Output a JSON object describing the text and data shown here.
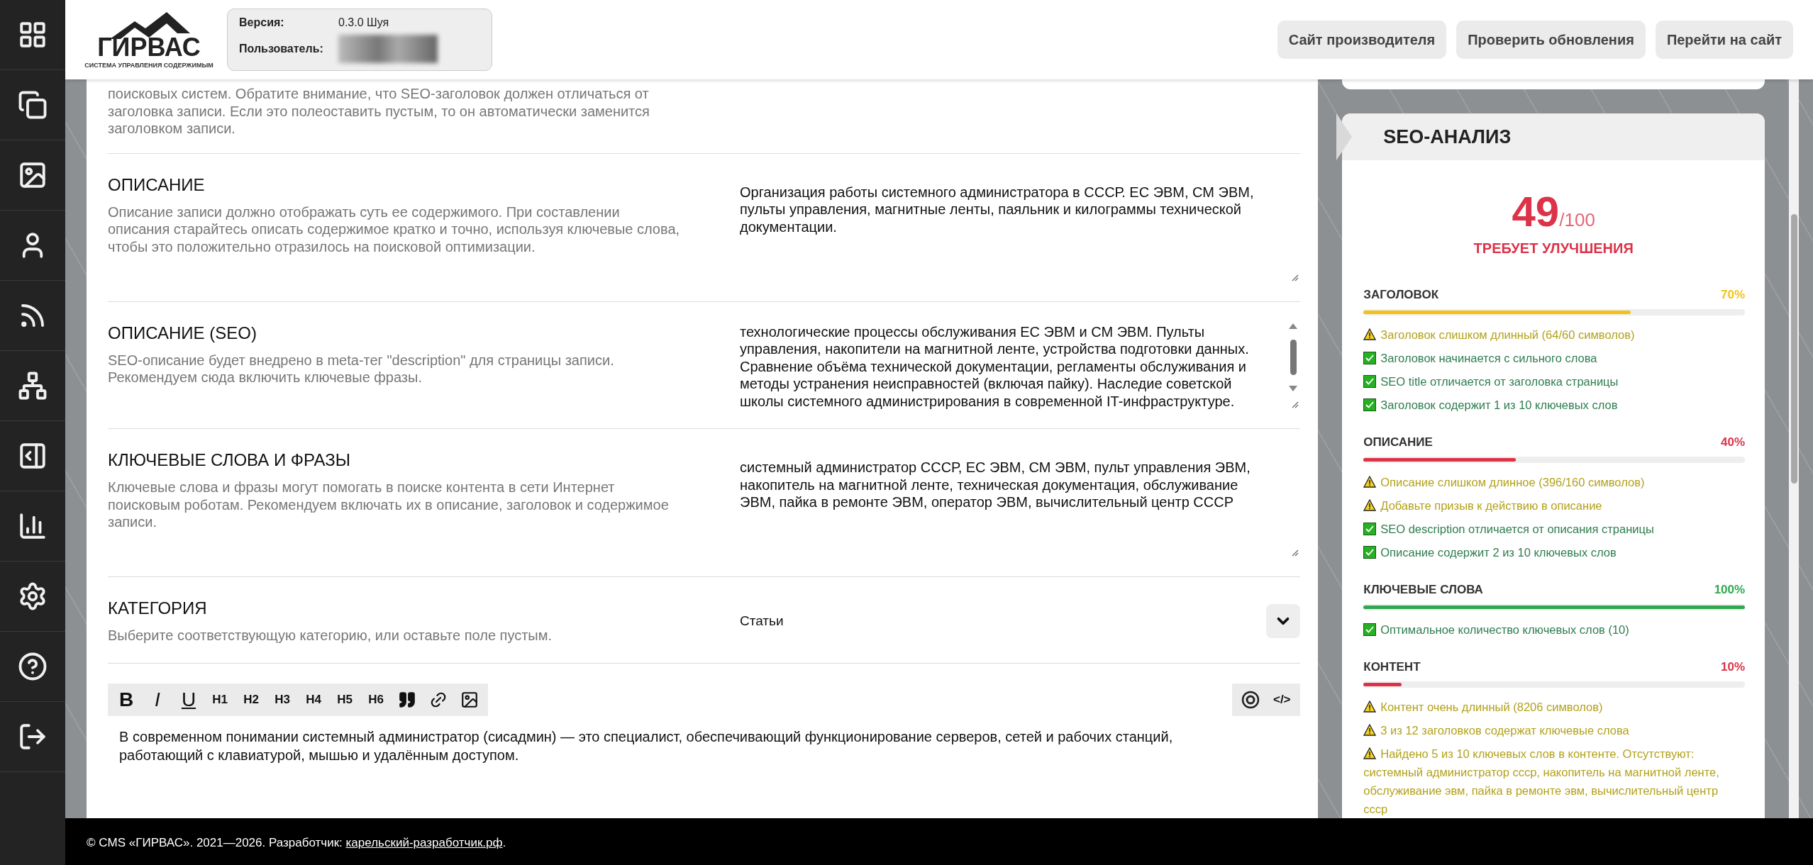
{
  "header": {
    "logo": {
      "name": "ГИРВАС",
      "tagline": "СИСТЕМА УПРАВЛЕНИЯ СОДЕРЖИМЫМ"
    },
    "info": [
      {
        "label": "Версия:",
        "kind": "text",
        "value": "0.3.0 Шуя"
      },
      {
        "label": "Пользователь:",
        "kind": "blurred"
      }
    ],
    "buttons": [
      "Сайт производителя",
      "Проверить обновления",
      "Перейти на сайт"
    ]
  },
  "form": {
    "sections": [
      {
        "kind": "note",
        "description": "поисковых систем. Обратите внимание, что SEO-заголовок должен отличаться от заголовка записи. Если это полеоставить пустым, то он автоматически заменится заголовком записи."
      },
      {
        "kind": "textarea",
        "title": "ОПИСАНИЕ",
        "description": "Описание записи должно отображать суть ее содержимого. При составлении описания старайтесь описать содержимое кратко и точно, используя ключевые слова, чтобы это положительно отразилось на поисковой оптимизации.",
        "value": "Организация работы системного администратора в СССР. ЕС ЭВМ, СМ ЭВМ, пульты управления, магнитные ленты, паяльник и килограммы технической документации."
      },
      {
        "kind": "scroll_textarea",
        "title": "ОПИСАНИЕ (SEO)",
        "description": "SEO-описание будет внедрено в meta-тег \"description\" для страницы записи. Рекомендуем сюда включить ключевые фразы.",
        "value": "технологические процессы обслуживания ЕС ЭВМ и СМ ЭВМ. Пульты управления, накопители на магнитной ленте, устройства подготовки данных. Сравнение объёма технической документации, регламенты обслуживания и методы устранения неисправностей (включая пайку). Наследие советской школы системного администрирования в современной IT-инфраструктуре."
      },
      {
        "kind": "textarea",
        "title": "КЛЮЧЕВЫЕ СЛОВА И ФРАЗЫ",
        "description": "Ключевые слова и фразы могут помогать в поиске контента в сети Интернет поисковым роботам. Рекомендуем включать их в описание, заголовок и содержимое записи.",
        "value": "системный администратор СССР, ЕС ЭВМ, СМ ЭВМ, пульт управления ЭВМ, накопитель на магнитной ленте, техническая документация, обслуживание ЭВМ, пайка в ремонте ЭВМ, оператор ЭВМ, вычислительный центр СССР"
      },
      {
        "kind": "select",
        "title": "КАТЕГОРИЯ",
        "description": "Выберите соответствующую категорию, или оставьте поле пустым.",
        "value": "Статьи"
      }
    ],
    "editor": {
      "toolbar": [
        {
          "kind": "bold",
          "label": "B"
        },
        {
          "kind": "italic",
          "label": "I"
        },
        {
          "kind": "underline",
          "label": "U"
        },
        {
          "kind": "heading",
          "label": "H1"
        },
        {
          "kind": "heading",
          "label": "H2"
        },
        {
          "kind": "heading",
          "label": "H3"
        },
        {
          "kind": "heading",
          "label": "H4"
        },
        {
          "kind": "heading",
          "label": "H5"
        },
        {
          "kind": "heading",
          "label": "H6"
        },
        {
          "kind": "quote"
        },
        {
          "kind": "link"
        },
        {
          "kind": "image"
        }
      ],
      "tools": [
        {
          "kind": "copyright"
        },
        {
          "kind": "code",
          "label": "</>"
        }
      ],
      "content": "В современном понимании системный администратор (сисадмин) — это специалист, обеспечивающий функционирование серверов, сетей и рабочих станций, работающий с клавиатурой, мышью и удалённым доступом."
    }
  },
  "seo": {
    "title": "SEO-АНАЛИЗ",
    "score": "49",
    "max": "/100",
    "color": "#dc3349",
    "verdict": "ТРЕБУЕТ УЛУЧШЕНИЯ",
    "groups": [
      {
        "name": "ЗАГОЛОВОК",
        "percent": "70%",
        "level": 0.7,
        "color": "#f2c218",
        "checks": [
          {
            "kind": "warning",
            "text": "Заголовок слишком длинный (64/60 символов)"
          },
          {
            "kind": "ok",
            "text": "Заголовок начинается с сильного слова"
          },
          {
            "kind": "ok",
            "text": "SEO title отличается от заголовка страницы"
          },
          {
            "kind": "ok",
            "text": "Заголовок содержит 1 из 10 ключевых слов"
          }
        ]
      },
      {
        "name": "ОПИСАНИЕ",
        "percent": "40%",
        "level": 0.4,
        "color": "#dc3349",
        "checks": [
          {
            "kind": "warning",
            "text": "Описание слишком длинное (396/160 символов)"
          },
          {
            "kind": "warning",
            "text": "Добавьте призыв к действию в описание"
          },
          {
            "kind": "ok",
            "text": "SEO description отличается от описания страницы"
          },
          {
            "kind": "ok",
            "text": "Описание содержит 2 из 10 ключевых слов"
          }
        ]
      },
      {
        "name": "КЛЮЧЕВЫЕ СЛОВА",
        "percent": "100%",
        "level": 1,
        "color": "#2fa84f",
        "checks": [
          {
            "kind": "ok",
            "text": "Оптимальное количество ключевых слов (10)"
          }
        ]
      },
      {
        "name": "КОНТЕНТ",
        "percent": "10%",
        "level": 0.1,
        "color": "#dc3349",
        "checks": [
          {
            "kind": "warning",
            "text": "Контент очень длинный (8206 символов)"
          },
          {
            "kind": "warning",
            "text": "3 из 12 заголовков содержат ключевые слова"
          },
          {
            "kind": "warning",
            "text": "Найдено 5 из 10 ключевых слов в контенте. Отсутствуют: системный администратор ссср, накопитель на магнитной ленте, обслуживание эвм, пайка в ремонте эвм, вычислительный центр ссср"
          }
        ]
      }
    ]
  },
  "footer": {
    "text": "© CMS «ГИРВАС». 2021—2026. Разработчик: ",
    "link": "карельский-разработчик.рф",
    "after": "."
  }
}
